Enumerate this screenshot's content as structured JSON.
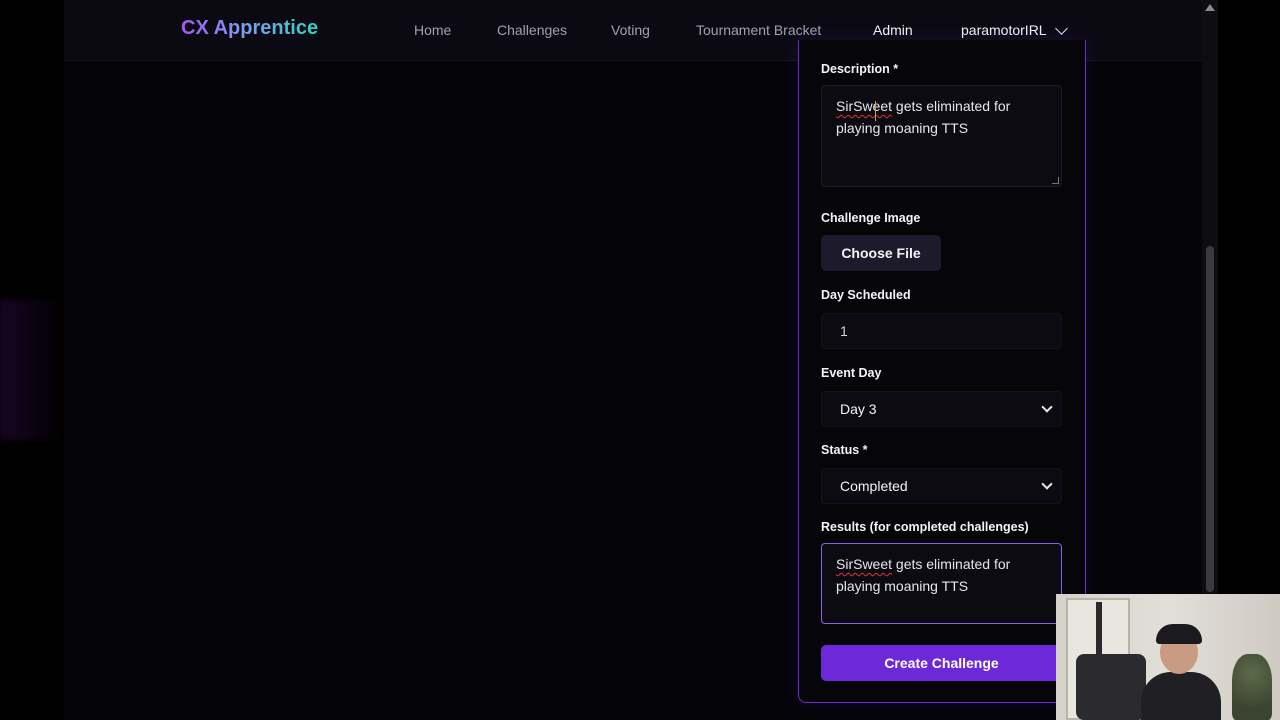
{
  "nav": {
    "brand": "CX Apprentice",
    "links": [
      {
        "label": "Home"
      },
      {
        "label": "Challenges"
      },
      {
        "label": "Voting"
      },
      {
        "label": "Tournament Bracket"
      },
      {
        "label": "Admin"
      }
    ],
    "user": "paramotorIRL"
  },
  "form": {
    "description": {
      "label": "Description *",
      "value_misspelled": "SirSweet",
      "value_rest": " gets eliminated for playing moaning TTS"
    },
    "image": {
      "label": "Challenge Image",
      "button": "Choose File"
    },
    "day_scheduled": {
      "label": "Day Scheduled",
      "value": "1"
    },
    "event_day": {
      "label": "Event Day",
      "value": "Day 3"
    },
    "status": {
      "label": "Status *",
      "value": "Completed"
    },
    "results": {
      "label": "Results (for completed challenges)",
      "value_misspelled": "SirSweet",
      "value_rest": " gets eliminated for playing moaning TTS"
    },
    "submit": "Create Challenge"
  },
  "colors": {
    "accent": "#6d28d9",
    "focus_border": "#8b5cf6",
    "background": "#050409"
  }
}
